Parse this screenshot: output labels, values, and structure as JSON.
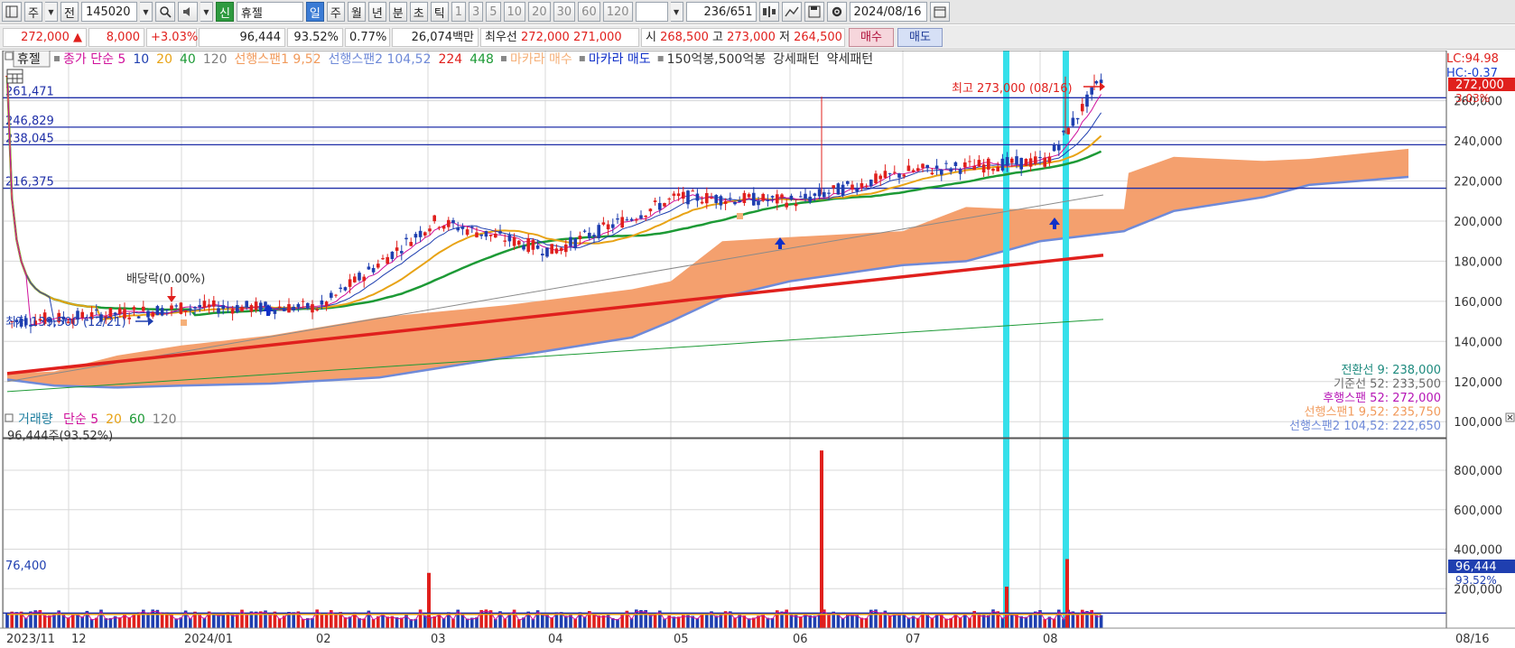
{
  "toolbar": {
    "period_label": "주",
    "prev_label": "전",
    "code": "145020",
    "badge": "신",
    "stock_name": "휴젤",
    "periods": [
      "일",
      "주",
      "월",
      "년",
      "분",
      "초",
      "틱"
    ],
    "period_active": 0,
    "intervals": [
      "1",
      "3",
      "5",
      "10",
      "20",
      "30",
      "60",
      "120"
    ],
    "count": "236",
    "total": "/651",
    "date": "2024/08/16"
  },
  "quote": {
    "price": "272,000",
    "arrow": "▲",
    "change": "8,000",
    "change_pct": "+3.03%",
    "volume": "96,444",
    "volume_ratio": "93.52%",
    "turnover_pct": "0.77%",
    "amount": "26,074백만",
    "bid_label": "최우선",
    "ask": "272,000",
    "bid": "271,000",
    "open_label": "시",
    "open": "268,500",
    "high_label": "고",
    "high": "273,000",
    "low_label": "저",
    "low": "264,500",
    "buy_button": "매수",
    "sell_button": "매도"
  },
  "legend": {
    "stock_tag": "휴젤",
    "items": [
      {
        "text": "종가 단순 5",
        "color": "#d0109b"
      },
      {
        "text": "10",
        "color": "#1f3fb0"
      },
      {
        "text": "20",
        "color": "#e8a315"
      },
      {
        "text": "40",
        "color": "#1d9a36"
      },
      {
        "text": "120",
        "color": "#7f7f7f"
      },
      {
        "text": "선행스팬1 9,52",
        "color": "#f19a5b"
      },
      {
        "text": "선행스팬2 104,52",
        "color": "#6f8ad8"
      },
      {
        "text": "224",
        "color": "#e0201d"
      },
      {
        "text": "448",
        "color": "#1d9a36"
      },
      {
        "text": "마카라 매수",
        "color": "#f5b079"
      },
      {
        "text": "마카라 매도",
        "color": "#1030c8"
      },
      {
        "text": "150억봉,500억봉",
        "color": "#333333"
      },
      {
        "text": "강세패턴",
        "color": "#333333"
      },
      {
        "text": "약세패턴",
        "color": "#333333"
      }
    ],
    "lc": "LC:94.98",
    "hc": "HC:-0.37"
  },
  "annotations": {
    "high": "최고 273,000 (08/16)",
    "low": "최저 139,500 (12/21)",
    "dividend": "배당락(0.00%)",
    "current_tag": "272,000",
    "current_pct": "3.03%"
  },
  "h_lines": [
    "261,471",
    "246,829",
    "238,045",
    "216,375"
  ],
  "ichimoku_values": [
    {
      "label": "전환선 9:",
      "value": "238,000",
      "color": "#1d8a7e"
    },
    {
      "label": "기준선 52:",
      "value": "233,500",
      "color": "#6a6a6a"
    },
    {
      "label": "후행스팬 52:",
      "value": "272,000",
      "color": "#b616b6"
    },
    {
      "label": "선행스팬1 9,52:",
      "value": "235,750",
      "color": "#f19a5b"
    },
    {
      "label": "선행스팬2 104,52:",
      "value": "222,650",
      "color": "#6f8ad8"
    }
  ],
  "volume_legend": {
    "title": "거래량",
    "items": [
      {
        "text": "단순 5",
        "color": "#d0109b"
      },
      {
        "text": "20",
        "color": "#e8a315"
      },
      {
        "text": "60",
        "color": "#1d9a36"
      },
      {
        "text": "120",
        "color": "#7f7f7f"
      }
    ],
    "current": "96,444주(93.52%)",
    "baseline": "76,400",
    "current_tag": "96,444",
    "current_pct": "93.52%"
  },
  "x_labels": [
    "2023/11",
    "12",
    "2024/01",
    "02",
    "03",
    "04",
    "05",
    "06",
    "07",
    "08"
  ],
  "x_end_label": "08/16",
  "chart_data": [
    {
      "type": "candlestick",
      "title": "",
      "ylim": [
        92000,
        285000
      ],
      "y_ticks": [
        100000,
        120000,
        140000,
        160000,
        180000,
        200000,
        220000,
        240000,
        260000
      ],
      "ma5_sample": [
        {
          "x": "2023/11",
          "y": 150000
        },
        {
          "x": "12",
          "y": 152000
        },
        {
          "x": "2024/01",
          "y": 157000
        },
        {
          "x": "02",
          "y": 157000
        },
        {
          "x": "03",
          "y": 200000
        },
        {
          "x": "04",
          "y": 185000
        },
        {
          "x": "05",
          "y": 212000
        },
        {
          "x": "06",
          "y": 210000
        },
        {
          "x": "07",
          "y": 225000
        },
        {
          "x": "08",
          "y": 230000
        },
        {
          "x": "08/16",
          "y": 272000
        }
      ],
      "ma224": [
        {
          "x": "2023/11",
          "y": 124000
        },
        {
          "x": "08/16",
          "y": 183000
        }
      ],
      "ma448": [
        {
          "x": "2023/11",
          "y": 115000
        },
        {
          "x": "08/16",
          "y": 151000
        }
      ],
      "ma120": [
        {
          "x": "2023/11",
          "y": 120000
        },
        {
          "x": "08/16",
          "y": 213000
        }
      ],
      "high": 273000,
      "low": 139500
    },
    {
      "type": "bar",
      "title": "",
      "ylim": [
        0,
        960000
      ],
      "y_ticks": [
        200000,
        400000,
        600000,
        800000
      ],
      "spikes": [
        {
          "x": "03",
          "value": 280000
        },
        {
          "x": "06",
          "value": 900000
        },
        {
          "x": "07/30",
          "value": 210000
        },
        {
          "x": "08/06",
          "value": 350000
        }
      ],
      "current": 96444
    }
  ]
}
